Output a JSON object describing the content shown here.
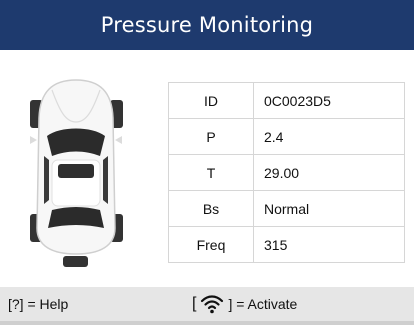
{
  "header": {
    "title": "Pressure Monitoring"
  },
  "sensor_info": {
    "rows": [
      {
        "key": "ID",
        "value": "0C0023D5"
      },
      {
        "key": "P",
        "value": "2.4"
      },
      {
        "key": "T",
        "value": "29.00"
      },
      {
        "key": "Bs",
        "value": "Normal"
      },
      {
        "key": "Freq",
        "value": "315"
      }
    ]
  },
  "footer": {
    "help_label": "[?] = Help",
    "activate_open": "[",
    "activate_close": "] = Activate",
    "activate_icon": "wifi-signal-icon"
  },
  "colors": {
    "header_bg": "#1e3a6e",
    "footer_bg": "#e6e6e6",
    "active_wheel_indicator": "#333333"
  }
}
